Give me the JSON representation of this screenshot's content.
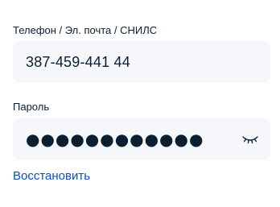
{
  "login": {
    "label": "Телефон / Эл. почта / СНИЛС",
    "value": "387-459-441 44"
  },
  "password": {
    "label": "Пароль",
    "masked_value": "●●●●●●●●●●●●",
    "toggle_icon": "eye-closed-icon"
  },
  "restore_link": "Восстановить",
  "colors": {
    "text": "#0b1f33",
    "field_bg": "#f5f7fa",
    "link": "#0d4cd3"
  }
}
